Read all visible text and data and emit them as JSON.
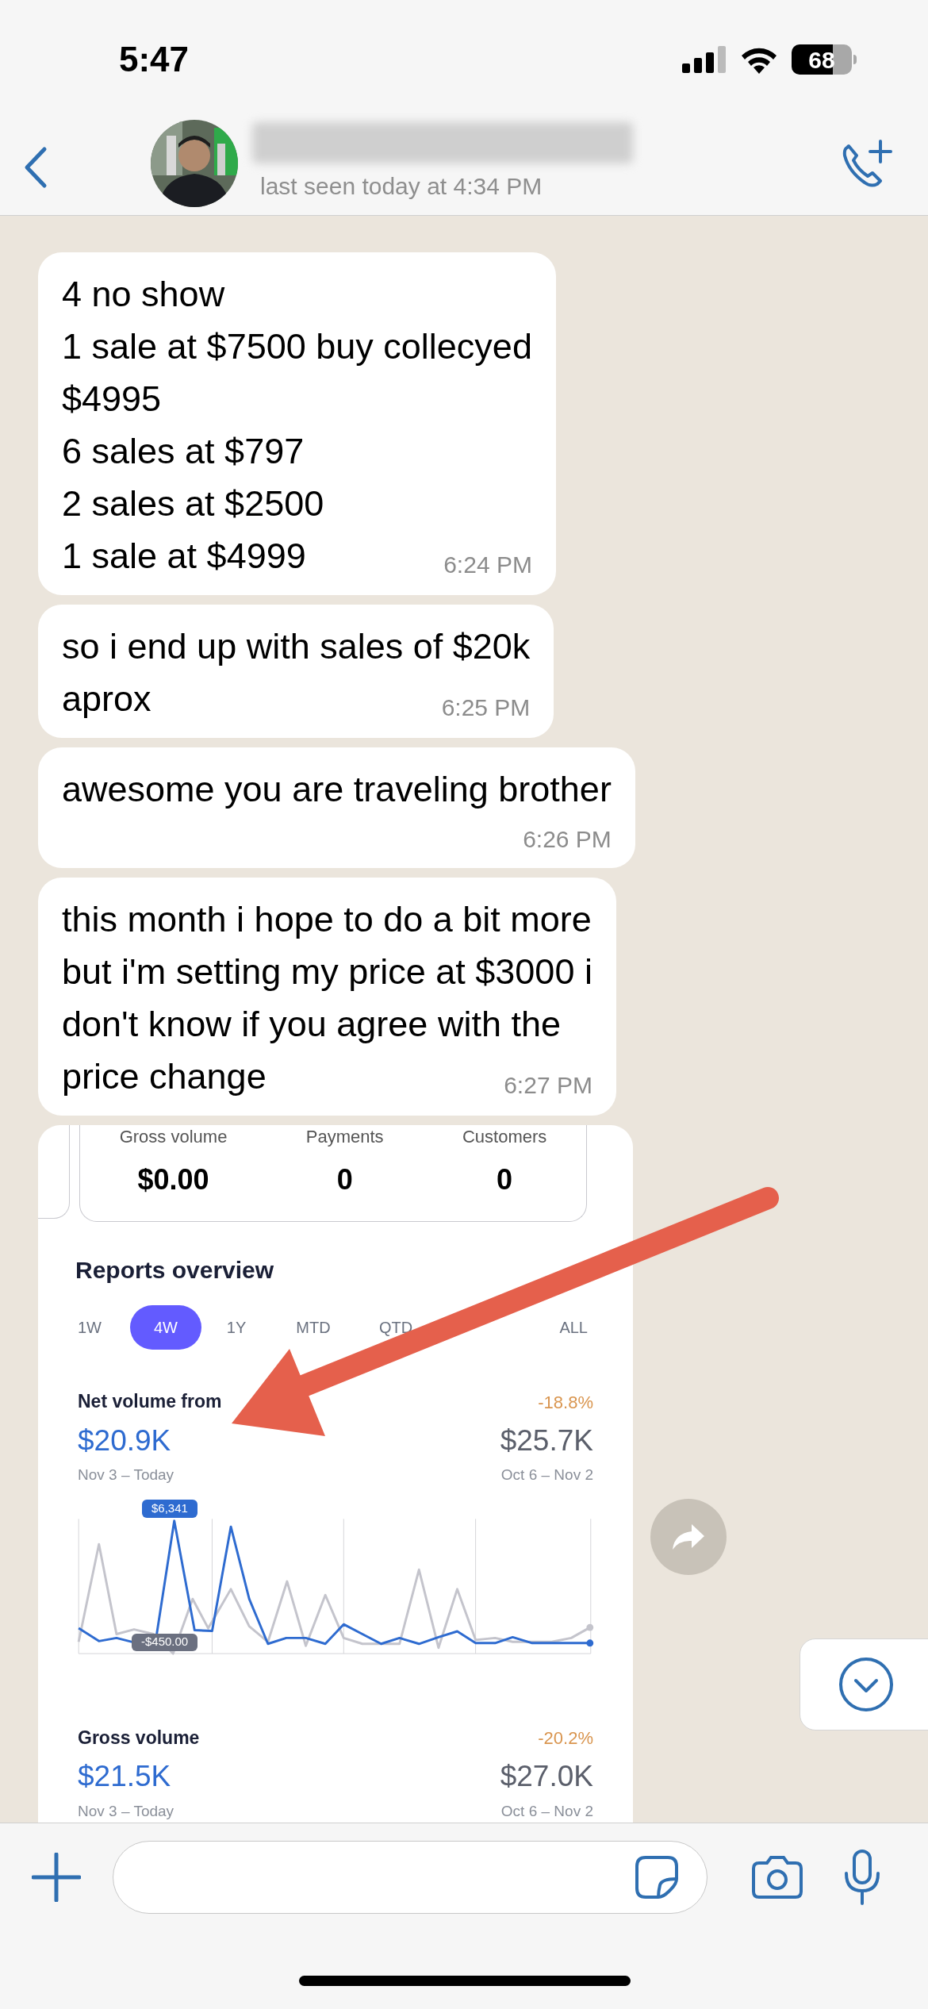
{
  "status_bar": {
    "time": "5:47",
    "battery": "68"
  },
  "header": {
    "last_seen": "last seen today at 4:34 PM"
  },
  "messages": [
    {
      "kind": "text",
      "lines": [
        "4 no show",
        "1 sale at $7500 buy collecyed",
        "$4995",
        "6 sales at $797",
        "2 sales at $2500",
        "1 sale at $4999"
      ],
      "time": "6:24 PM"
    },
    {
      "kind": "text",
      "lines": [
        "so i end up with sales of $20k",
        "aprox"
      ],
      "time": "6:25 PM"
    },
    {
      "kind": "text",
      "lines": [
        "awesome you are traveling brother"
      ],
      "time": "6:26 PM"
    },
    {
      "kind": "text",
      "lines": [
        "this month i hope to do a bit more",
        "but i'm setting my price at $3000 i",
        "don't know if you agree with the",
        "price change"
      ],
      "time": "6:27 PM"
    },
    {
      "kind": "screenshot",
      "summary": [
        {
          "label": "Gross volume",
          "value": "$0.00"
        },
        {
          "label": "Payments",
          "value": "0"
        },
        {
          "label": "Customers",
          "value": "0"
        }
      ],
      "reports_title": "Reports overview",
      "tabs": [
        {
          "label": "1W",
          "selected": false
        },
        {
          "label": "4W",
          "selected": true
        },
        {
          "label": "1Y",
          "selected": false
        },
        {
          "label": "MTD",
          "selected": false
        },
        {
          "label": "QTD",
          "selected": false
        },
        {
          "label": "ALL",
          "selected": false
        }
      ],
      "metrics": [
        {
          "label": "Net volume from",
          "change": "-18.8%",
          "value": "$20.9K",
          "period": "Nov 3 – Today",
          "previous_value": "$25.7K",
          "previous_period": "Oct 6 – Nov 2",
          "tooltip_high": "$6,341",
          "tooltip_low": "-$450.00"
        },
        {
          "label": "Gross volume",
          "change": "-20.2%",
          "value": "$21.5K",
          "period": "Nov 3 – Today",
          "previous_value": "$27.0K",
          "previous_period": "Oct 6 – Nov 2"
        }
      ]
    }
  ]
}
